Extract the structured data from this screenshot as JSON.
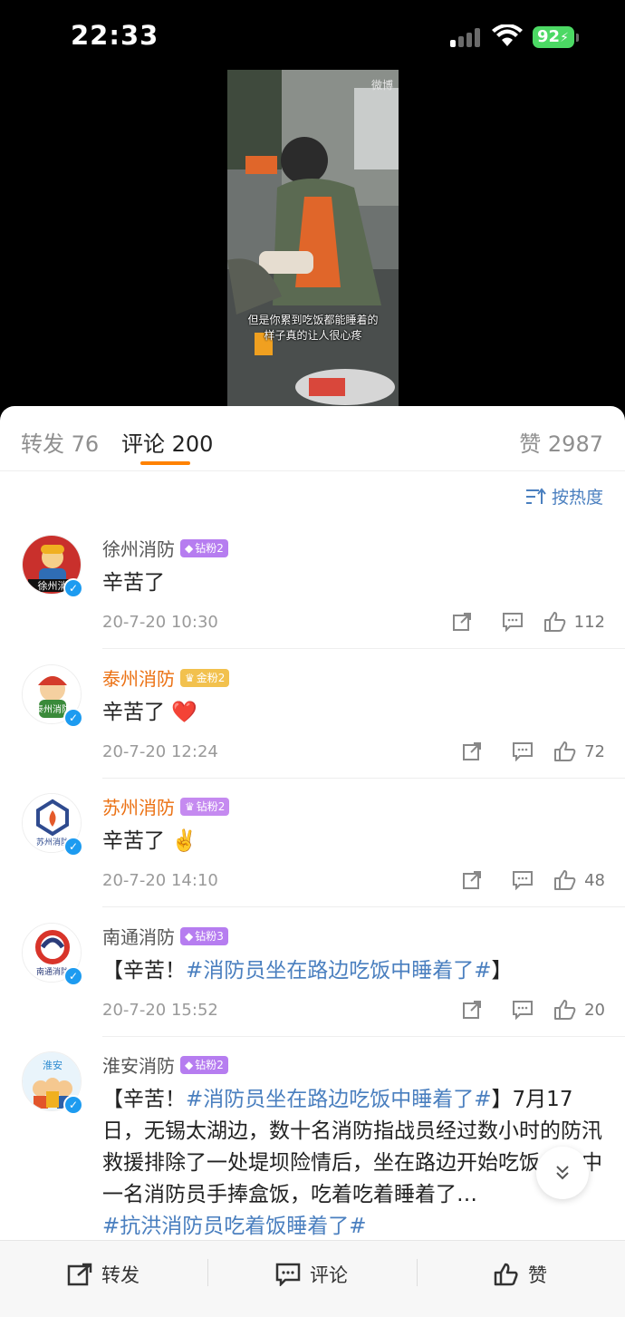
{
  "status_bar": {
    "time": "22:33",
    "battery": "92"
  },
  "video": {
    "logo": "微博",
    "subtitle_line1": "但是你累到吃饭都能睡着的",
    "subtitle_line2": "样子真的让人很心疼"
  },
  "tabs": {
    "repost": "转发 76",
    "comment": "评论 200",
    "like": "赞 2987"
  },
  "sort_label": "按热度",
  "comments": [
    {
      "name": "徐州消防",
      "badge": "钻粉2",
      "badge_style": "purple",
      "name_color": "gray",
      "text": "辛苦了",
      "date": "20-7-20 10:30",
      "likes": "112"
    },
    {
      "name": "泰州消防",
      "badge": "金粉2",
      "badge_style": "gold",
      "name_color": "orange",
      "text": "辛苦了",
      "emoji": "❤️",
      "date": "20-7-20 12:24",
      "likes": "72"
    },
    {
      "name": "苏州消防",
      "badge": "钻粉2",
      "badge_style": "purple",
      "name_color": "orange",
      "text": "辛苦了",
      "emoji": "✌️",
      "date": "20-7-20 14:10",
      "likes": "48"
    },
    {
      "name": "南通消防",
      "badge": "钻粉3",
      "badge_style": "purple",
      "name_color": "gray",
      "text_prefix": "【辛苦！",
      "topic": "#消防员坐在路边吃饭中睡着了#",
      "text_suffix": "】",
      "date": "20-7-20 15:52",
      "likes": "20"
    },
    {
      "name": "淮安消防",
      "badge": "钻粉2",
      "badge_style": "purple",
      "name_color": "gray",
      "text_prefix": "【辛苦！",
      "topic": "#消防员坐在路边吃饭中睡着了#",
      "text_body": "】7月17日，无锡太湖边，数十名消防指战员经过数小时的防汛救援排除了一处堤坝险情后，坐在路边开始吃饭，其中一名消防员手捧盒饭，吃着吃着睡着了…",
      "topic2": "#抗洪消防员吃着饭睡着了#"
    }
  ],
  "bottom_bar": {
    "repost": "转发",
    "comment": "评论",
    "like": "赞"
  },
  "colors": {
    "accent": "#ff8200",
    "link": "#4a7fbf",
    "verified": "#1d9bf0"
  }
}
